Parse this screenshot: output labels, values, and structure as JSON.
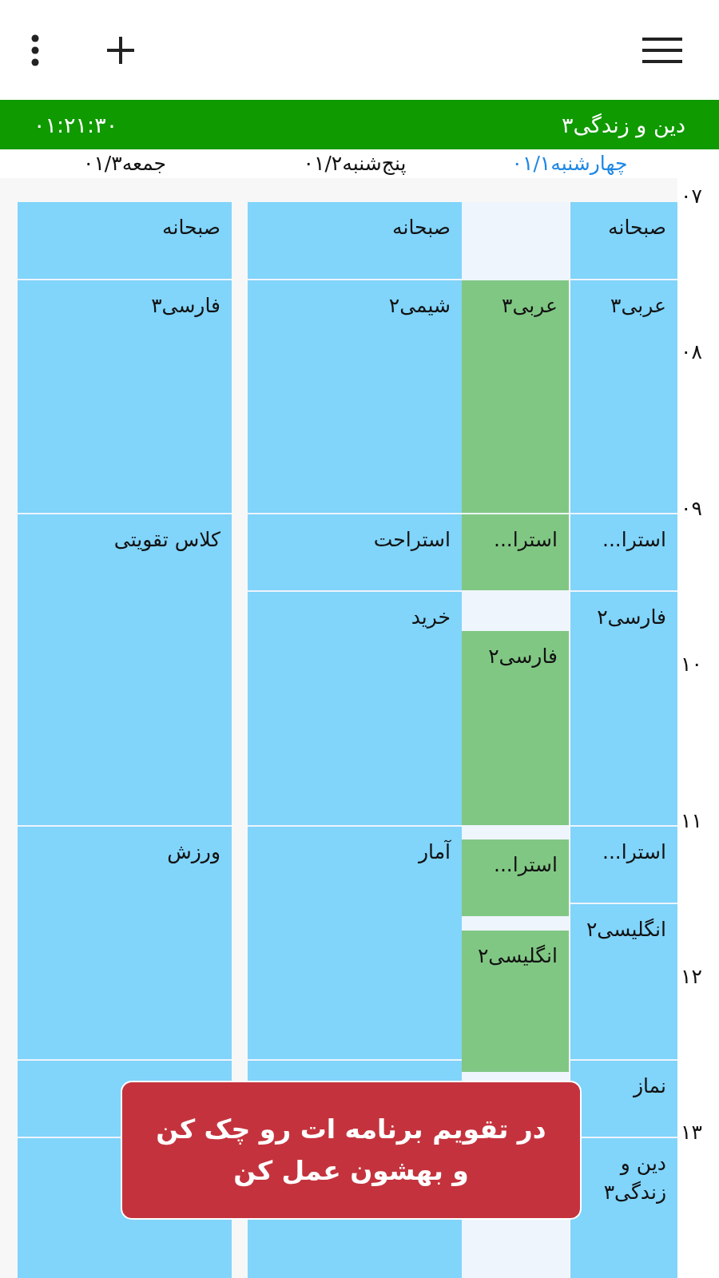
{
  "toolbar": {
    "title": "دین و زندگی۳",
    "timer": "۰۱:۲۱:۳۰"
  },
  "hours": [
    "۰۷",
    "۰۸",
    "۰۹",
    "۱۰",
    "۱۱",
    "۱۲",
    "۱۳"
  ],
  "days": [
    {
      "label": "چهارشنبه۰۱/۱",
      "selected": true,
      "lanes": [
        [
          {
            "kind": "half",
            "title": "صبحانه",
            "color": "#81d4fa"
          },
          {
            "kind": "long",
            "title": "عربی۳",
            "color": "#81d4fa"
          },
          {
            "kind": "half",
            "title": "استرا...",
            "color": "#81d4fa"
          },
          {
            "kind": "long",
            "title": "فارسی۲",
            "color": "#81d4fa"
          },
          {
            "kind": "half",
            "title": "استرا...",
            "color": "#81d4fa"
          },
          {
            "kind": "hour",
            "title": "انگلیسی۲",
            "color": "#81d4fa"
          },
          {
            "kind": "half",
            "title": "نماز",
            "color": "#81d4fa"
          },
          {
            "kind": "hour",
            "title": "دین و زندگی۳",
            "color": "#81d4fa"
          }
        ],
        [
          {
            "kind": "pause"
          },
          {
            "kind": "long",
            "title": "عربی۳",
            "color": "#81c784"
          },
          {
            "kind": "half",
            "title": "استرا...",
            "color": "#81c784"
          },
          {
            "kind": "break"
          },
          {
            "kind": "extended",
            "title": "فارسی۲",
            "color": "#81c784"
          },
          {
            "kind": "space"
          },
          {
            "kind": "half",
            "title": "استرا...",
            "color": "#81c784"
          },
          {
            "kind": "space"
          },
          {
            "kind": "brief",
            "title": "انگلیسی۲",
            "color": "#81c784"
          }
        ]
      ]
    },
    {
      "label": "پنج‌شنبه۰۱/۲",
      "selected": false,
      "lanes": [
        [
          {
            "kind": "half",
            "title": "صبحانه",
            "color": "#81d4fa"
          },
          {
            "kind": "long",
            "title": "شیمی۲",
            "color": "#81d4fa"
          },
          {
            "kind": "half",
            "title": "استراحت",
            "color": "#81d4fa"
          },
          {
            "kind": "long",
            "title": "خرید",
            "color": "#81d4fa"
          },
          {
            "kind": "long",
            "title": "آمار",
            "color": "#81d4fa"
          },
          {
            "kind": "half",
            "color": "#81d4fa"
          },
          {
            "kind": "hour",
            "color": "#81d4fa"
          }
        ]
      ]
    },
    {
      "label": "جمعه۰۱/۳",
      "selected": false,
      "lanes": [
        [
          {
            "kind": "half",
            "title": "صبحانه",
            "color": "#81d4fa"
          },
          {
            "kind": "long",
            "title": "فارسی۳",
            "color": "#81d4fa"
          },
          {
            "kind": "double",
            "title": "کلاس تقویتی",
            "color": "#81d4fa"
          },
          {
            "kind": "long",
            "title": "ورزش",
            "color": "#81d4fa"
          },
          {
            "kind": "half",
            "color": "#81d4fa"
          },
          {
            "kind": "hour",
            "color": "#81d4fa"
          }
        ]
      ]
    }
  ],
  "toast": "در تقویم برنامه ات رو چک کن و بهشون عمل کن"
}
